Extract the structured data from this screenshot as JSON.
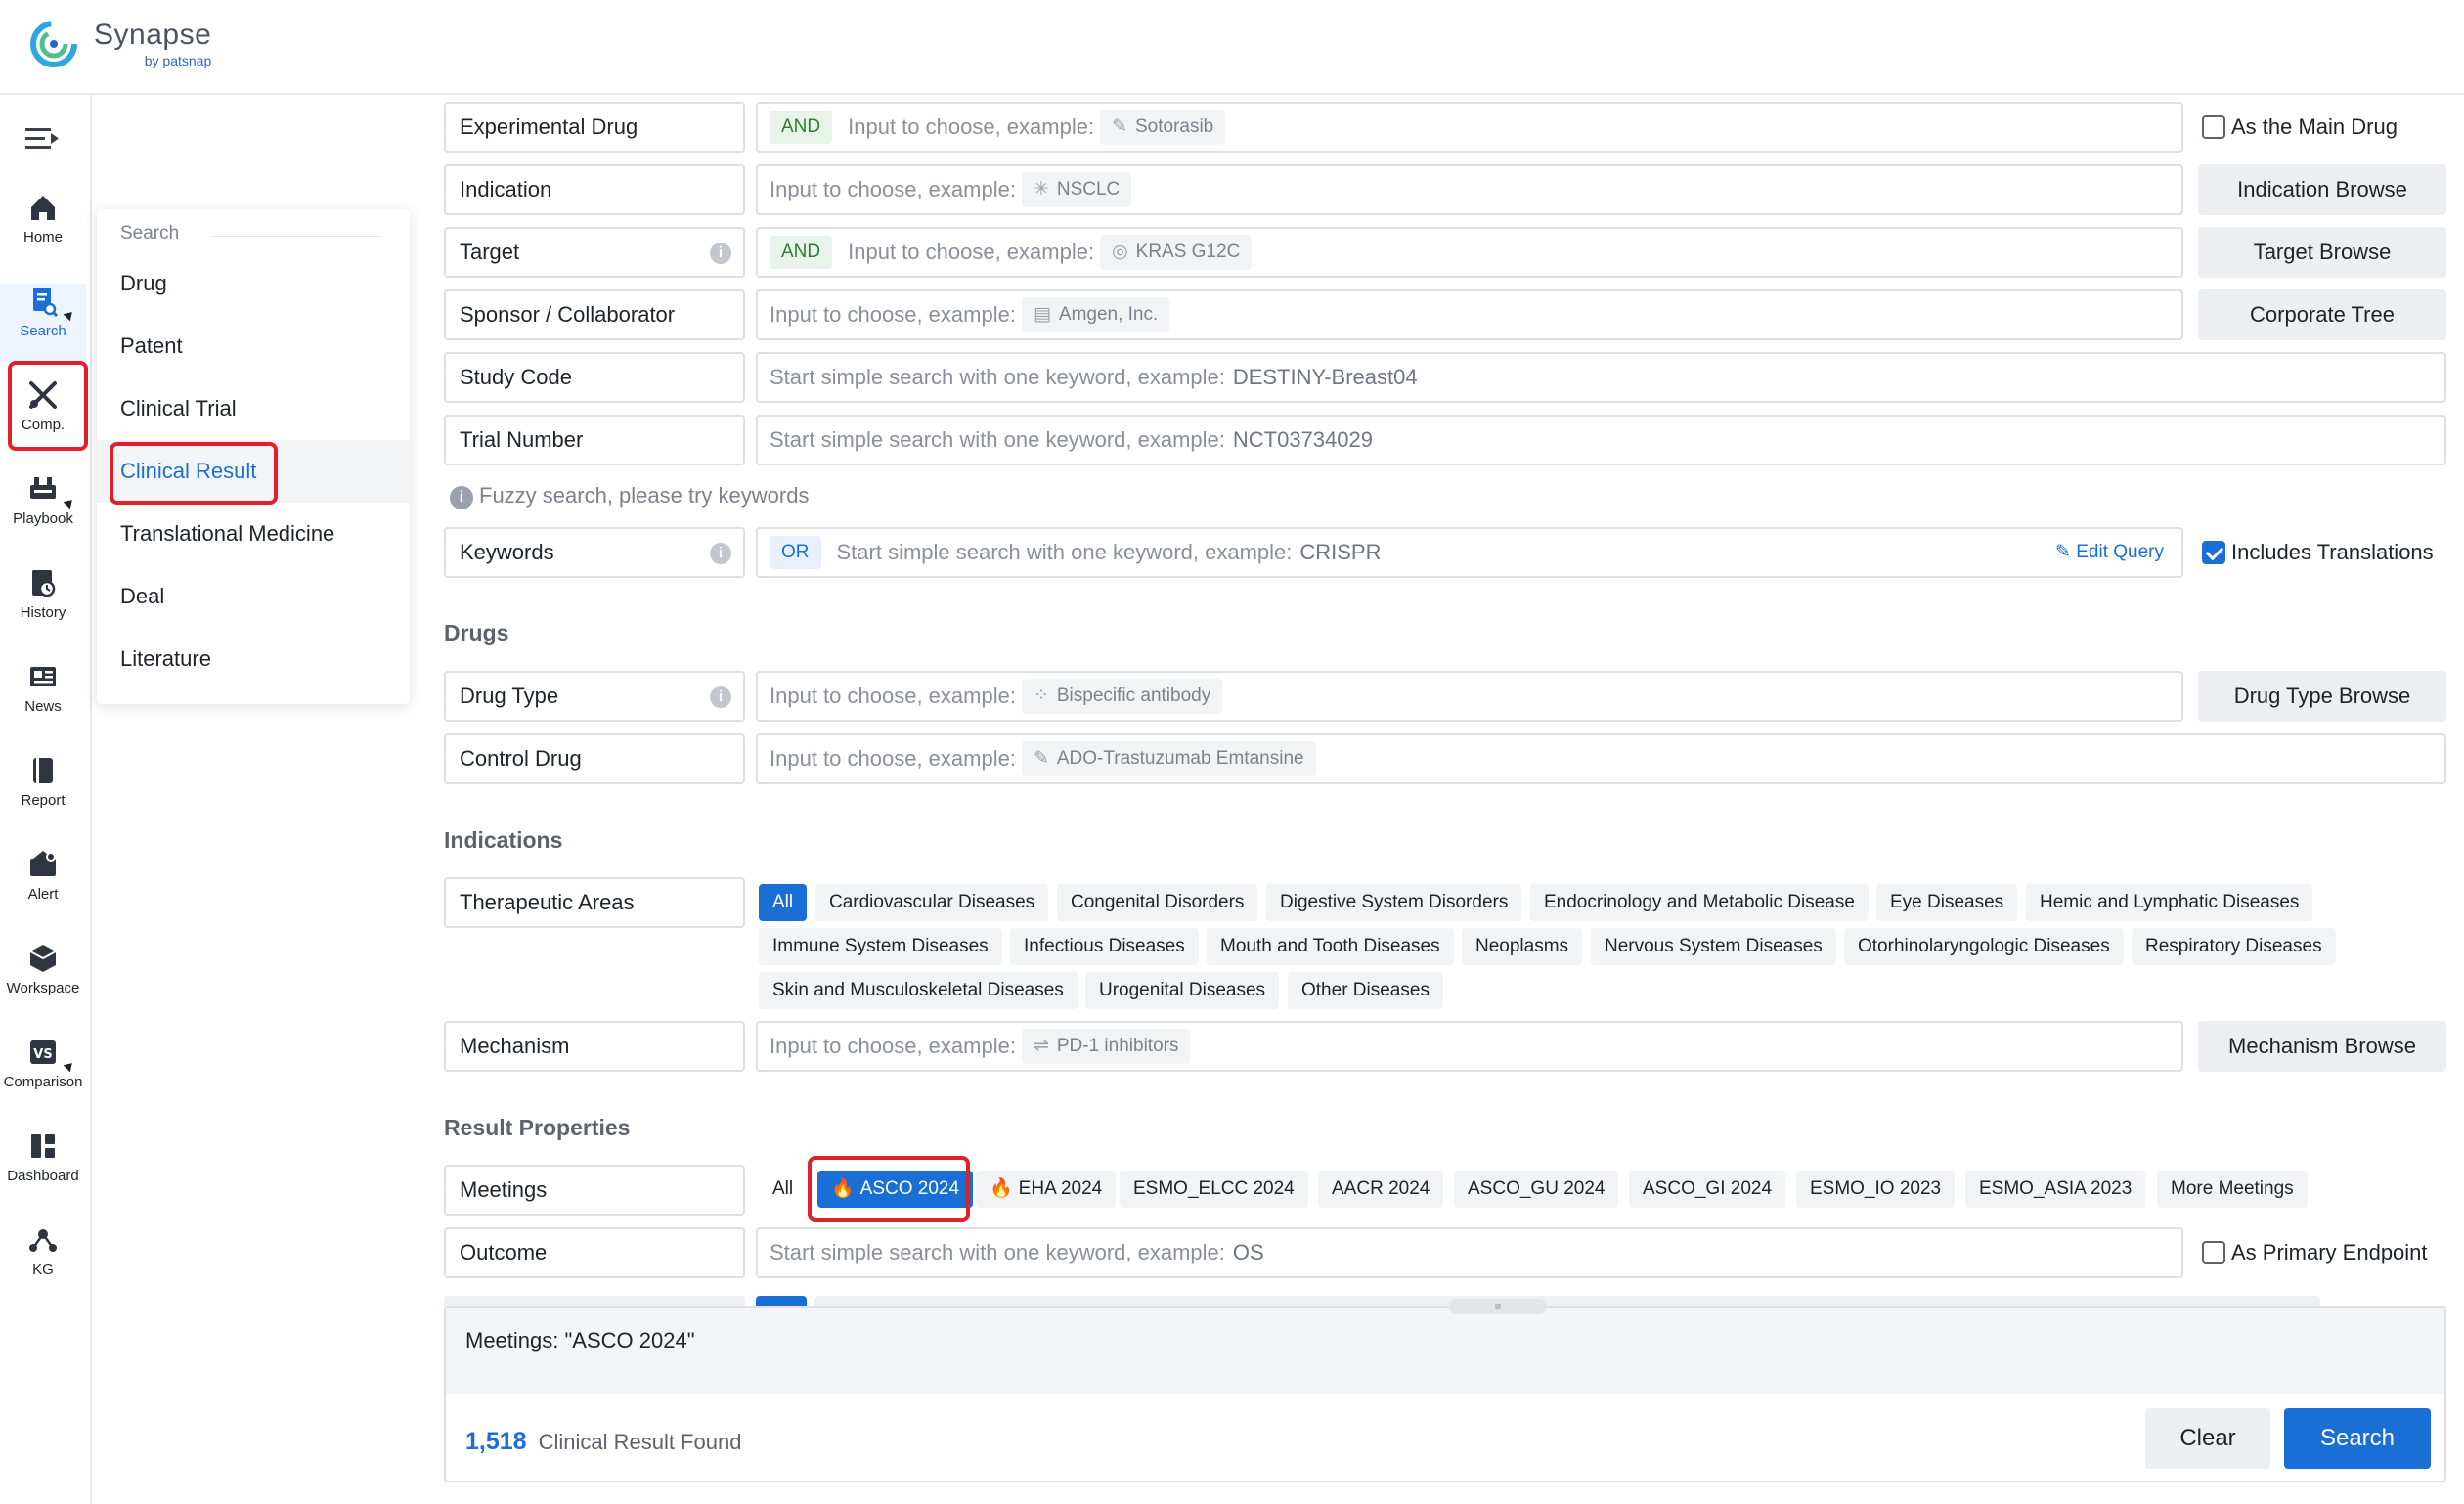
{
  "app": {
    "name": "Synapse",
    "sub": "by patsnap"
  },
  "rail": [
    {
      "label": "Home",
      "icon": "home-icon"
    },
    {
      "label": "Search",
      "icon": "search-doc-icon",
      "active": true
    },
    {
      "label": "Comp.",
      "icon": "competitive-icon"
    },
    {
      "label": "Playbook",
      "icon": "playbook-icon"
    },
    {
      "label": "History",
      "icon": "history-icon"
    },
    {
      "label": "News",
      "icon": "news-icon"
    },
    {
      "label": "Report",
      "icon": "report-icon"
    },
    {
      "label": "Alert",
      "icon": "alert-icon"
    },
    {
      "label": "Workspace",
      "icon": "workspace-icon"
    },
    {
      "label": "Comparison",
      "icon": "comparison-icon"
    },
    {
      "label": "Dashboard",
      "icon": "dashboard-icon"
    },
    {
      "label": "KG",
      "icon": "kg-icon"
    }
  ],
  "menu": {
    "heading": "Search",
    "items": [
      "Drug",
      "Patent",
      "Clinical Trial",
      "Clinical Result",
      "Translational Medicine",
      "Deal",
      "Literature"
    ],
    "active": "Clinical Result"
  },
  "fields": {
    "experimental_drug": {
      "label": "Experimental Drug",
      "op": "AND",
      "placeholder": "Input to choose, example:",
      "example": "Sotorasib",
      "check": "As the Main Drug"
    },
    "indication": {
      "label": "Indication",
      "placeholder": "Input to choose, example:",
      "example": "NSCLC",
      "button": "Indication Browse"
    },
    "target": {
      "label": "Target",
      "op": "AND",
      "placeholder": "Input to choose, example:",
      "example": "KRAS G12C",
      "button": "Target Browse"
    },
    "sponsor": {
      "label": "Sponsor / Collaborator",
      "placeholder": "Input to choose, example:",
      "example": "Amgen, Inc.",
      "button": "Corporate Tree"
    },
    "study_code": {
      "label": "Study Code",
      "placeholder": "Start simple search with one keyword, example:",
      "example": "DESTINY-Breast04"
    },
    "trial_number": {
      "label": "Trial Number",
      "placeholder": "Start simple search with one keyword, example:",
      "example": "NCT03734029"
    },
    "fuzzy_note": "Fuzzy search, please try keywords",
    "keywords": {
      "label": "Keywords",
      "op": "OR",
      "placeholder": "Start simple search with one keyword, example:",
      "example": "CRISPR",
      "edit": "Edit Query",
      "check": "Includes Translations"
    }
  },
  "drugs": {
    "title": "Drugs",
    "drug_type": {
      "label": "Drug Type",
      "placeholder": "Input to choose, example:",
      "example": "Bispecific antibody",
      "button": "Drug Type Browse"
    },
    "control_drug": {
      "label": "Control Drug",
      "placeholder": "Input to choose, example:",
      "example": "ADO-Trastuzumab Emtansine"
    }
  },
  "indications": {
    "title": "Indications",
    "therapeutic_label": "Therapeutic Areas",
    "areas": [
      "All",
      "Cardiovascular Diseases",
      "Congenital Disorders",
      "Digestive System Disorders",
      "Endocrinology and Metabolic Disease",
      "Eye Diseases",
      "Hemic and Lymphatic Diseases",
      "Immune System Diseases",
      "Infectious Diseases",
      "Mouth and Tooth Diseases",
      "Neoplasms",
      "Nervous System Diseases",
      "Otorhinolaryngologic Diseases",
      "Respiratory Diseases",
      "Skin and Musculoskeletal Diseases",
      "Urogenital Diseases",
      "Other Diseases"
    ],
    "mechanism": {
      "label": "Mechanism",
      "placeholder": "Input to choose, example:",
      "example": "PD-1 inhibitors",
      "button": "Mechanism Browse"
    }
  },
  "result": {
    "title": "Result Properties",
    "meetings_label": "Meetings",
    "meetings": [
      "All",
      "ASCO 2024",
      "EHA 2024",
      "ESMO_ELCC 2024",
      "AACR 2024",
      "ASCO_GU 2024",
      "ASCO_GI 2024",
      "ESMO_IO 2023",
      "ESMO_ASIA 2023",
      "More Meetings"
    ],
    "selected_meeting": "ASCO 2024",
    "outcome": {
      "label": "Outcome",
      "placeholder": "Start simple search with one keyword, example:",
      "example": "OS",
      "check": "As Primary Endpoint"
    }
  },
  "bottom": {
    "query": "Meetings: \"ASCO 2024\"",
    "count": "1,518",
    "count_label": "Clinical Result Found",
    "clear": "Clear",
    "search": "Search"
  },
  "colors": {
    "accent": "#1a6fd6",
    "highlight": "#e0202a"
  }
}
